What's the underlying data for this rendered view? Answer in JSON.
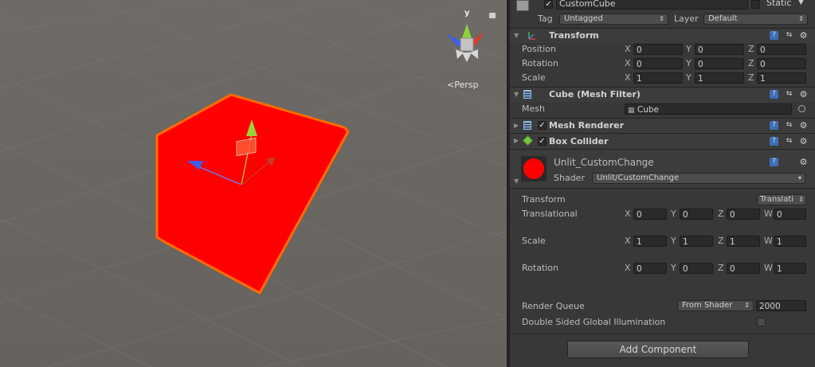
{
  "scene": {
    "persp_label": "Persp",
    "gizmo_y_label": "y",
    "cube_color": "#ff0000",
    "cube_outline": "#ff6a00"
  },
  "header": {
    "object_name": "CustomCube",
    "static_label": "Static",
    "tag_label": "Tag",
    "tag_value": "Untagged",
    "layer_label": "Layer",
    "layer_value": "Default"
  },
  "transform": {
    "title": "Transform",
    "rows": [
      {
        "label": "Position",
        "x": "0",
        "y": "0",
        "z": "0"
      },
      {
        "label": "Rotation",
        "x": "0",
        "y": "0",
        "z": "0"
      },
      {
        "label": "Scale",
        "x": "1",
        "y": "1",
        "z": "1"
      }
    ],
    "axes": {
      "x": "X",
      "y": "Y",
      "z": "Z"
    }
  },
  "mesh_filter": {
    "title": "Cube (Mesh Filter)",
    "mesh_label": "Mesh",
    "mesh_value": "Cube"
  },
  "mesh_renderer": {
    "title": "Mesh Renderer"
  },
  "box_collider": {
    "title": "Box Collider"
  },
  "material": {
    "name": "Unlit_CustomChange",
    "shader_label": "Shader",
    "shader_value": "Unlit/CustomChange",
    "swatch_color": "#ff0000"
  },
  "shader_props": {
    "transform_label": "Transform",
    "transform_mode": "Translati",
    "vectors": [
      {
        "label": "Translational",
        "x": "0",
        "y": "0",
        "z": "0",
        "w": "0"
      },
      {
        "label": "Scale",
        "x": "1",
        "y": "1",
        "z": "1",
        "w": "1"
      },
      {
        "label": "Rotation",
        "x": "0",
        "y": "0",
        "z": "0",
        "w": "1"
      }
    ],
    "axes": {
      "x": "X",
      "y": "Y",
      "z": "Z",
      "w": "W"
    },
    "render_queue_label": "Render Queue",
    "render_queue_mode": "From Shader",
    "render_queue_value": "2000",
    "dsgi_label": "Double Sided Global Illumination"
  },
  "add_component_label": "Add Component"
}
